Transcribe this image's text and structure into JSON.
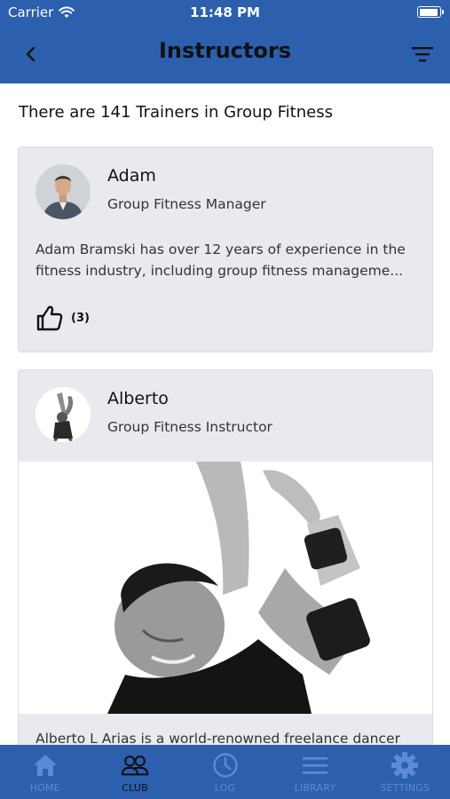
{
  "status": {
    "carrier": "Carrier",
    "time": "11:48 PM"
  },
  "nav": {
    "title": "Instructors"
  },
  "summary": "There are 141 Trainers in Group Fitness",
  "trainers": [
    {
      "name": "Adam",
      "role": "Group Fitness Manager",
      "bio": "Adam Bramski has over 12 years of experience in the fitness industry, including group fitness manageme...",
      "likes": "(3)"
    },
    {
      "name": "Alberto",
      "role": "Group Fitness Instructor",
      "bio": "Alberto L Arias is a world-renowned freelance dancer"
    }
  ],
  "tabs": [
    {
      "label": "HOME",
      "icon": "home-icon"
    },
    {
      "label": "CLUB",
      "icon": "group-icon",
      "active": true
    },
    {
      "label": "LOG",
      "icon": "clock-icon"
    },
    {
      "label": "LIBRARY",
      "icon": "list-icon"
    },
    {
      "label": "SETTINGS",
      "icon": "gear-icon"
    }
  ],
  "colors": {
    "header": "#2c5fad",
    "tab_inactive": "#5b8bd4",
    "card": "#e9eaee"
  }
}
